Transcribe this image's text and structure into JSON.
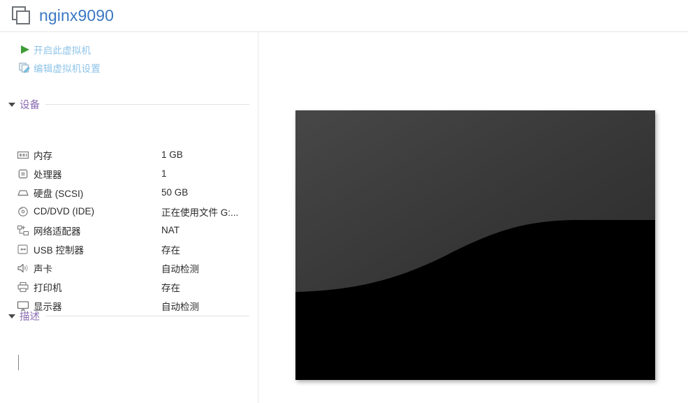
{
  "header": {
    "title": "nginx9090",
    "icon": "vm-stacked-squares-icon",
    "title_color": "#3b78c3"
  },
  "actions": [
    {
      "label": "开启此虚拟机",
      "icon": "play-triangle-icon",
      "icon_color": "#3f9c35",
      "text_color": "#8fc4e8"
    },
    {
      "label": "编辑虚拟机设置",
      "icon": "edit-settings-icon",
      "icon_color": "#9fb9cc",
      "text_color": "#8fc4e8"
    }
  ],
  "devices_section": {
    "title": "设备",
    "title_color": "#8a6bb1",
    "expanded": true,
    "rows": [
      {
        "icon": "memory-icon",
        "name": "内存",
        "value": "1 GB"
      },
      {
        "icon": "processor-icon",
        "name": "处理器",
        "value": "1"
      },
      {
        "icon": "harddisk-icon",
        "name": "硬盘 (SCSI)",
        "value": "50 GB"
      },
      {
        "icon": "cd-dvd-icon",
        "name": "CD/DVD (IDE)",
        "value": "正在使用文件 G:..."
      },
      {
        "icon": "network-icon",
        "name": "网络适配器",
        "value": "NAT"
      },
      {
        "icon": "usb-icon",
        "name": "USB 控制器",
        "value": "存在"
      },
      {
        "icon": "sound-card-icon",
        "name": "声卡",
        "value": "自动检测"
      },
      {
        "icon": "printer-icon",
        "name": "打印机",
        "value": "存在"
      },
      {
        "icon": "display-icon",
        "name": "显示器",
        "value": "自动检测"
      }
    ]
  },
  "description_section": {
    "title": "描述",
    "title_color": "#8a6bb1",
    "expanded": true,
    "value": "",
    "placeholder": ""
  },
  "preview": {
    "name": "vm-screen-thumbnail",
    "top_color": "#3f3f3f",
    "mid_color": "#2e2e2e",
    "bottom_color": "#000000"
  }
}
